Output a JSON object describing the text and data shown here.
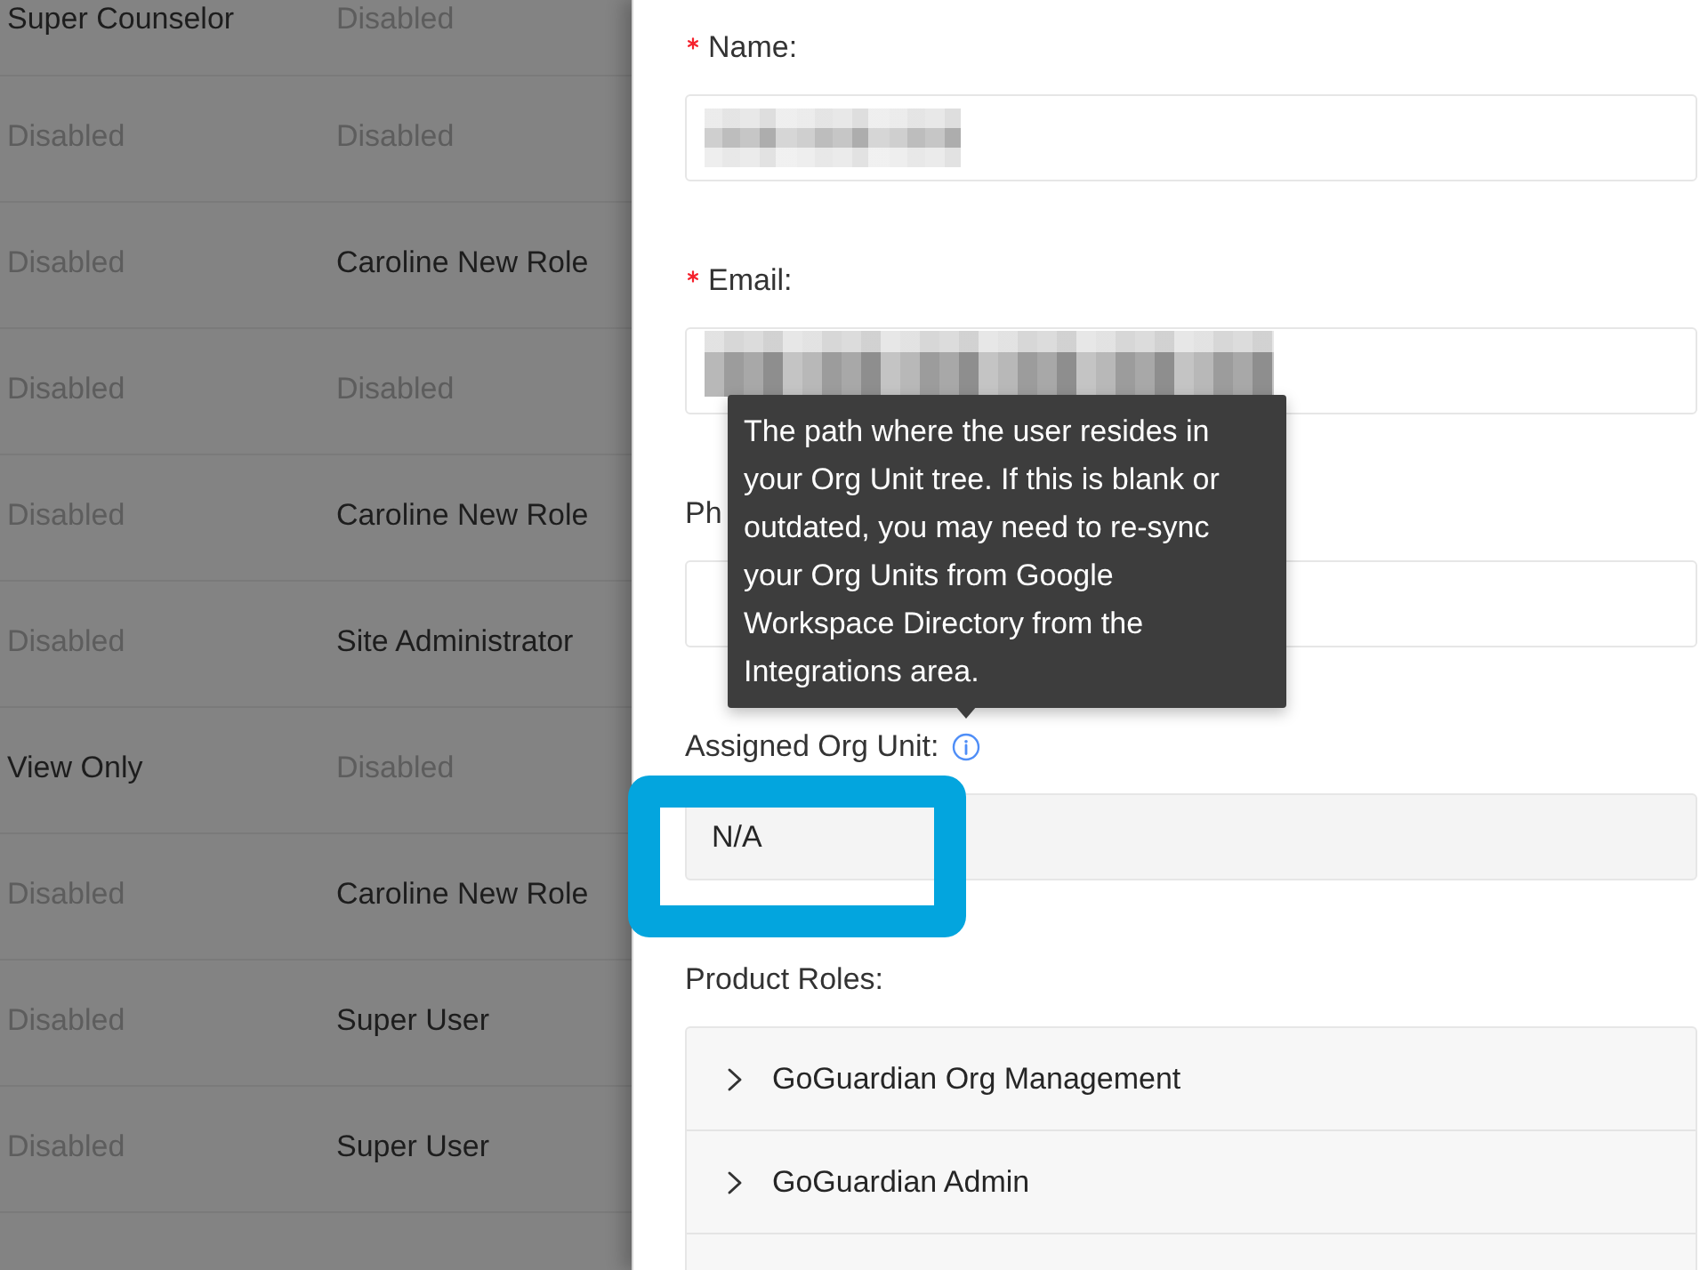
{
  "user_table": {
    "rows": [
      {
        "cells": [
          {
            "text": "Super Counselor",
            "disabled": false
          },
          {
            "text": "Disabled",
            "disabled": true
          }
        ]
      },
      {
        "cells": [
          {
            "text": "Disabled",
            "disabled": true
          },
          {
            "text": "Disabled",
            "disabled": true
          }
        ]
      },
      {
        "cells": [
          {
            "text": "Disabled",
            "disabled": true
          },
          {
            "text": "Caroline New Role",
            "disabled": false
          }
        ]
      },
      {
        "cells": [
          {
            "text": "Disabled",
            "disabled": true
          },
          {
            "text": "Disabled",
            "disabled": true
          }
        ]
      },
      {
        "cells": [
          {
            "text": "Disabled",
            "disabled": true
          },
          {
            "text": "Caroline New Role",
            "disabled": false
          }
        ]
      },
      {
        "cells": [
          {
            "text": "Disabled",
            "disabled": true
          },
          {
            "text": "Site Administrator",
            "disabled": false
          }
        ]
      },
      {
        "cells": [
          {
            "text": "View Only",
            "disabled": false
          },
          {
            "text": "Disabled",
            "disabled": true
          }
        ]
      },
      {
        "cells": [
          {
            "text": "Disabled",
            "disabled": true
          },
          {
            "text": "Caroline New Role",
            "disabled": false
          }
        ]
      },
      {
        "cells": [
          {
            "text": "Disabled",
            "disabled": true
          },
          {
            "text": "Super User",
            "disabled": false
          }
        ]
      },
      {
        "cells": [
          {
            "text": "Disabled",
            "disabled": true
          },
          {
            "text": "Super User",
            "disabled": false
          }
        ]
      }
    ]
  },
  "user_drawer": {
    "form_items": [
      {
        "kind": "input",
        "label": "Name:",
        "required": true,
        "value_redacted": true
      },
      {
        "kind": "input",
        "label": "Email:",
        "required": true,
        "value_redacted": true
      },
      {
        "kind": "input",
        "label": "Ph",
        "required": false,
        "value_redacted": false
      },
      {
        "kind": "readonly",
        "label": "Assigned Org Unit:",
        "required": false,
        "tooltip": "The path where the user resides in your Org Unit tree. If this is blank or outdated, you may need to re-sync your Org Units from Google Workspace Directory from the Integrations area.",
        "value": "N/A",
        "highlighted": true
      },
      {
        "kind": "collapse",
        "label": "Product Roles:",
        "required": false,
        "panels": [
          {
            "title": "GoGuardian Org Management",
            "expanded": false
          },
          {
            "title": "GoGuardian Admin",
            "expanded": false
          }
        ]
      }
    ]
  }
}
